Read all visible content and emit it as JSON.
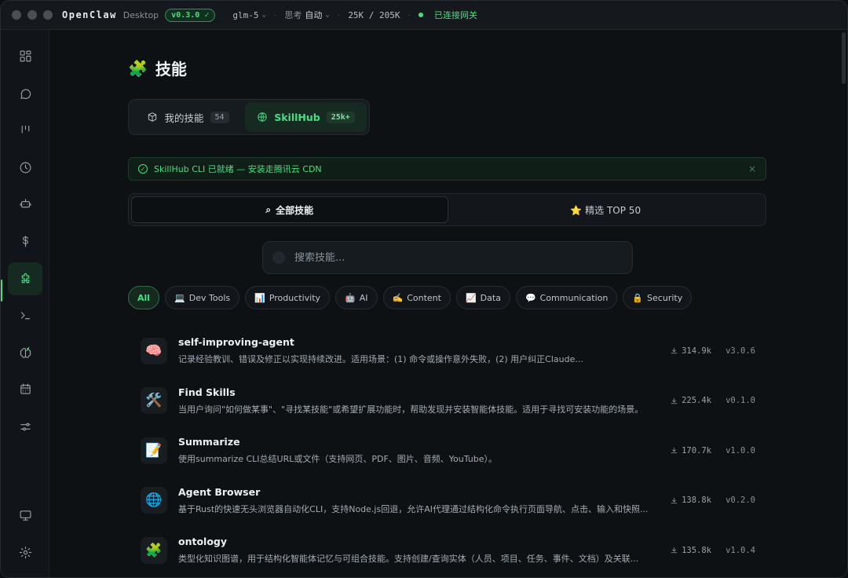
{
  "window": {
    "app_name": "OpenClaw",
    "app_sub": "Desktop",
    "version": "v0.3.0 ✓",
    "model": "glm-5",
    "think_label": "思考",
    "think_value": "自动",
    "tokens": "25K / 205K",
    "gateway_status": "已连接网关"
  },
  "sidebar": {
    "items": [
      {
        "icon": "dashboard-icon"
      },
      {
        "icon": "chat-icon"
      },
      {
        "icon": "kanban-icon"
      },
      {
        "icon": "clock-icon"
      },
      {
        "icon": "robot-icon"
      },
      {
        "icon": "dollar-icon"
      },
      {
        "icon": "puzzle-icon",
        "active": true
      },
      {
        "icon": "terminal-icon"
      },
      {
        "icon": "brain-icon"
      },
      {
        "icon": "calendar-icon"
      },
      {
        "icon": "sliders-icon"
      },
      {
        "icon": "monitor-icon"
      },
      {
        "icon": "gear-icon"
      }
    ]
  },
  "page": {
    "title": "技能",
    "tabs": [
      {
        "label": "我的技能",
        "count": "54"
      },
      {
        "label": "SkillHub",
        "count": "25k+"
      }
    ],
    "notice": "SkillHub CLI 已就绪 — 安装走腾讯云 CDN",
    "subtabs": [
      {
        "label": "全部技能"
      },
      {
        "label": "⭐ 精选 TOP 50"
      }
    ],
    "search_placeholder": "搜索技能...",
    "categories": [
      {
        "label": "All"
      },
      {
        "emoji": "💻",
        "label": "Dev Tools"
      },
      {
        "emoji": "📊",
        "label": "Productivity"
      },
      {
        "emoji": "🤖",
        "label": "AI"
      },
      {
        "emoji": "✍️",
        "label": "Content"
      },
      {
        "emoji": "📈",
        "label": "Data"
      },
      {
        "emoji": "💬",
        "label": "Communication"
      },
      {
        "emoji": "🔒",
        "label": "Security"
      }
    ],
    "skills": [
      {
        "emoji": "🧠",
        "name": "self-improving-agent",
        "desc": "记录经验教训、错误及修正以实现持续改进。适用场景：(1) 命令或操作意外失败，(2) 用户纠正Claude...",
        "downloads": "314.9k",
        "version": "v3.0.6"
      },
      {
        "emoji": "🛠️",
        "name": "Find Skills",
        "desc": "当用户询问\"如何做某事\"、\"寻找某技能\"或希望扩展功能时，帮助发现并安装智能体技能。适用于寻找可安装功能的场景。",
        "downloads": "225.4k",
        "version": "v0.1.0"
      },
      {
        "emoji": "📝",
        "name": "Summarize",
        "desc": "使用summarize CLI总结URL或文件（支持网页、PDF、图片、音频、YouTube）。",
        "downloads": "170.7k",
        "version": "v1.0.0"
      },
      {
        "emoji": "🌐",
        "name": "Agent Browser",
        "desc": "基于Rust的快速无头浏览器自动化CLI，支持Node.js回退，允许AI代理通过结构化命令执行页面导航、点击、输入和快照...",
        "downloads": "138.8k",
        "version": "v0.2.0"
      },
      {
        "emoji": "🧩",
        "name": "ontology",
        "desc": "类型化知识图谱，用于结构化智能体记忆与可组合技能。支持创建/查询实体（人员、项目、任务、事件、文档）及关联...",
        "downloads": "135.8k",
        "version": "v1.0.4"
      }
    ]
  }
}
